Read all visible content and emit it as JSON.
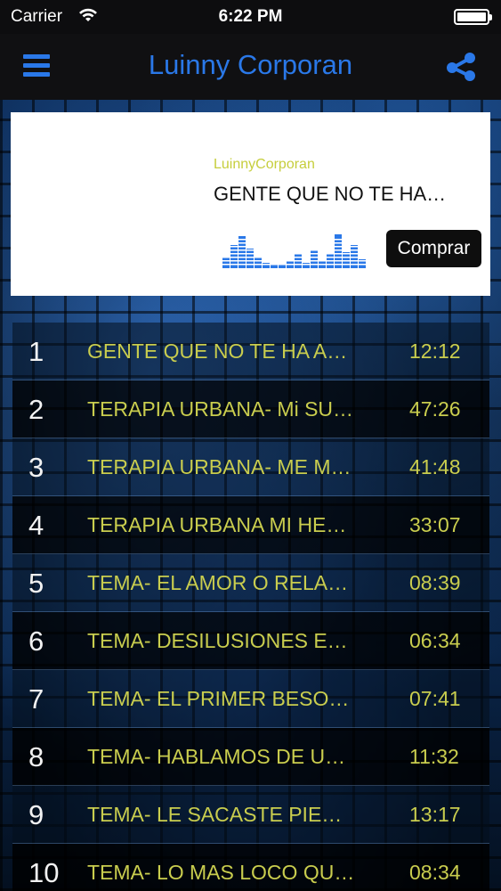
{
  "status_bar": {
    "carrier": "Carrier",
    "time": "6:22 PM"
  },
  "nav": {
    "title": "Luinny Corporan"
  },
  "player": {
    "artist": "LuinnyCorporan",
    "track": "GENTE QUE NO TE HA…",
    "buy_label": "Comprar"
  },
  "tracks": [
    {
      "num": "1",
      "name": "GENTE QUE NO TE HA A…",
      "duration": "12:12"
    },
    {
      "num": "2",
      "name": "TERAPIA URBANA- Mi SU…",
      "duration": "47:26"
    },
    {
      "num": "3",
      "name": "TERAPIA URBANA- ME M…",
      "duration": "41:48"
    },
    {
      "num": "4",
      "name": "TERAPIA URBANA MI HE…",
      "duration": "33:07"
    },
    {
      "num": "5",
      "name": "TEMA- EL AMOR O RELA…",
      "duration": "08:39"
    },
    {
      "num": "6",
      "name": "TEMA- DESILUSIONES E…",
      "duration": "06:34"
    },
    {
      "num": "7",
      "name": "TEMA- EL PRIMER BESO…",
      "duration": "07:41"
    },
    {
      "num": "8",
      "name": "TEMA- HABLAMOS DE U…",
      "duration": "11:32"
    },
    {
      "num": "9",
      "name": "TEMA- LE SACASTE PIE…",
      "duration": "13:17"
    },
    {
      "num": "10",
      "name": "TEMA- LO MAS LOCO QU…",
      "duration": "08:34"
    }
  ],
  "icons": {
    "menu": "hamburger-menu-icon",
    "share": "share-icon",
    "wifi": "wifi-icon",
    "battery": "battery-icon",
    "equalizer": "equalizer-icon"
  },
  "colors": {
    "accent_blue": "#2a78e8",
    "track_text": "#c9cd4e",
    "artist_text": "#c6ce3c"
  }
}
